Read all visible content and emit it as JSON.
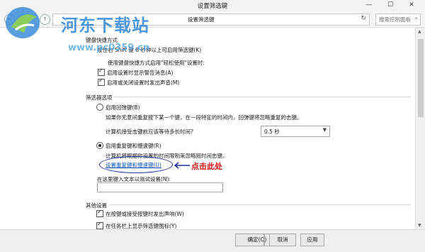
{
  "window": {
    "title": "设置筛选键",
    "minimize": "—",
    "maximize": "☐",
    "close": "✕"
  },
  "addressbar": {
    "crumb": "设置筛选键",
    "search_placeholder": "搜索控制面板",
    "refresh": "↻",
    "search_icon": "⌕"
  },
  "nav": {
    "back": "←",
    "forward": "→",
    "up": "↑"
  },
  "watermark": {
    "title": "河东下载站",
    "url": "www.pc0359.cn"
  },
  "sections": {
    "shortcut": {
      "header": "键盘快捷方式",
      "desc": "按住右 Shift 键 8 秒钟以上可启用筛选键(K)",
      "sub": "使用键盘快捷方式启用\"轻松使用\"设置时:",
      "opt1": "启用设置时显示警告消息(A)",
      "opt2": "启用或关闭设置时发出声音(M)"
    },
    "filter": {
      "header": "筛选器选项",
      "bounce_label": "启用回弹键(B)",
      "bounce_desc": "如果你无意间重复按下某一个键，在一段特定的时间内，回弹键将忽略重复的击键。",
      "wait_label": "计算机接受击键前应该等待多长时间?",
      "wait_value": "0.5 秒",
      "repeat_label": "启用重复键和慢速键(R)",
      "repeat_desc": "计算机将根据你设置的时间限制来忽略短时间击键。",
      "repeat_link": "设置重复键和慢速键(U)",
      "annotation": "点击此处",
      "test_label": "在这里键入文本以测试设置(N):"
    },
    "other": {
      "header": "其他设置",
      "opt1": "在按键或接受按键时发出声响(W)",
      "opt2": "在任务栏上显示筛选键图标(Y)"
    }
  },
  "buttons": {
    "ok": "确定(O)",
    "cancel": "取消",
    "apply": "应用"
  }
}
